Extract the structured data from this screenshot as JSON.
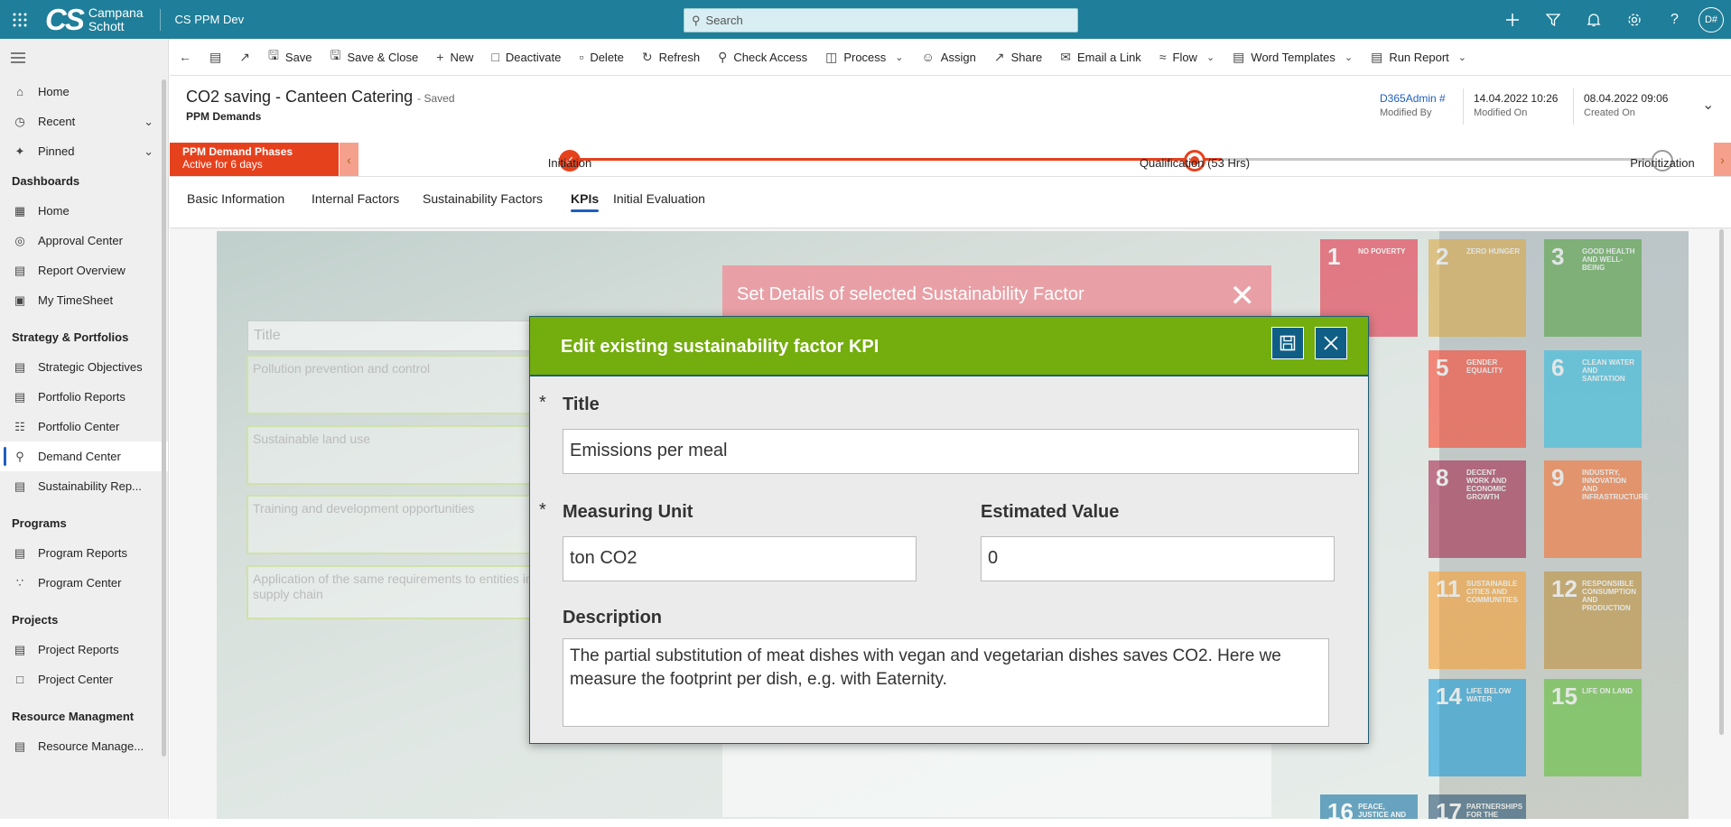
{
  "topbar": {
    "logo_mark": "CS",
    "logo_line1": "Campana",
    "logo_line2": "Schott",
    "app_name": "CS PPM Dev",
    "search_placeholder": "Search",
    "avatar_initials": "D#",
    "bg_color": "#1f7e99"
  },
  "sidebar": {
    "items_top": [
      {
        "label": "Home",
        "icon": "home-icon"
      },
      {
        "label": "Recent",
        "icon": "clock-icon"
      },
      {
        "label": "Pinned",
        "icon": "pin-icon"
      }
    ],
    "sections": [
      {
        "heading": "Dashboards",
        "items": [
          "Home",
          "Approval Center",
          "Report Overview",
          "My TimeSheet"
        ]
      },
      {
        "heading": "Strategy & Portfolios",
        "items": [
          "Strategic Objectives",
          "Portfolio Reports",
          "Portfolio Center",
          "Demand Center",
          "Sustainability Rep..."
        ]
      },
      {
        "heading": "Programs",
        "items": [
          "Program Reports",
          "Program Center"
        ]
      },
      {
        "heading": "Projects",
        "items": [
          "Project Reports",
          "Project Center"
        ]
      },
      {
        "heading": "Resource Managment",
        "items": [
          "Resource Manage..."
        ]
      }
    ],
    "selected": "Demand Center"
  },
  "commands": {
    "save": "Save",
    "save_close": "Save & Close",
    "new": "New",
    "deactivate": "Deactivate",
    "delete": "Delete",
    "refresh": "Refresh",
    "check_access": "Check Access",
    "process": "Process",
    "assign": "Assign",
    "share": "Share",
    "email_link": "Email a Link",
    "flow": "Flow",
    "word_templates": "Word Templates",
    "run_report": "Run Report"
  },
  "record": {
    "title": "CO2 saving - Canteen Catering",
    "saved_status": "- Saved",
    "entity": "PPM Demands",
    "modified_by": "D365Admin #",
    "modified_by_label": "Modified By",
    "modified_on": "14.04.2022 10:26",
    "modified_on_label": "Modified On",
    "created_on": "08.04.2022 09:06",
    "created_on_label": "Created On"
  },
  "bpf": {
    "name": "PPM Demand Phases",
    "duration": "Active for 6 days",
    "stages": [
      "Initiation",
      "Qualification  (53 Hrs)",
      "Prioritization"
    ],
    "accent": "#e6411d"
  },
  "tabs": [
    "Basic Information",
    "Internal Factors",
    "Sustainability Factors",
    "KPIs",
    "Initial Evaluation"
  ],
  "background_panel": {
    "heading": "Set Details of selected Sustainability Factor",
    "title_placeholder": "Title",
    "factors": [
      "Pollution prevention and control",
      "Sustainable land use",
      "Training and development opportunities",
      "Application of the same requirements to entities in the supply chain"
    ],
    "sdgs": [
      {
        "num": "1",
        "label": "NO POVERTY",
        "color": "#e5243b"
      },
      {
        "num": "2",
        "label": "ZERO HUNGER",
        "color": "#dda63a"
      },
      {
        "num": "3",
        "label": "GOOD HEALTH AND WELL-BEING",
        "color": "#4c9f38"
      },
      {
        "num": "5",
        "label": "GENDER EQUALITY",
        "color": "#ff3a21"
      },
      {
        "num": "6",
        "label": "CLEAN WATER AND SANITATION",
        "color": "#26bde2"
      },
      {
        "num": "8",
        "label": "DECENT WORK AND ECONOMIC GROWTH",
        "color": "#a21942"
      },
      {
        "num": "9",
        "label": "INDUSTRY, INNOVATION AND INFRASTRUCTURE",
        "color": "#fd6925"
      },
      {
        "num": "11",
        "label": "SUSTAINABLE CITIES AND COMMUNITIES",
        "color": "#fd9d24"
      },
      {
        "num": "12",
        "label": "RESPONSIBLE CONSUMPTION AND PRODUCTION",
        "color": "#bf8b2e"
      },
      {
        "num": "14",
        "label": "LIFE BELOW WATER",
        "color": "#0a97d9"
      },
      {
        "num": "15",
        "label": "LIFE ON LAND",
        "color": "#56c02b"
      },
      {
        "num": "16",
        "label": "PEACE, JUSTICE AND STRONG",
        "color": "#00689d"
      },
      {
        "num": "17",
        "label": "PARTNERSHIPS FOR THE GOALS",
        "color": "#19486a"
      }
    ]
  },
  "modal": {
    "title": "Edit existing sustainability factor KPI",
    "required_mark": "*",
    "title_label": "Title",
    "title_value": "Emissions per meal",
    "unit_label": "Measuring Unit",
    "unit_value": "ton CO2",
    "estimated_label": "Estimated Value",
    "estimated_value": "0",
    "description_label": "Description",
    "description_value": "The partial substitution of meat dishes with vegan and vegetarian dishes saves CO2. Here we measure the footprint per dish, e.g. with Eaternity.",
    "header_color": "#74ad0e"
  }
}
